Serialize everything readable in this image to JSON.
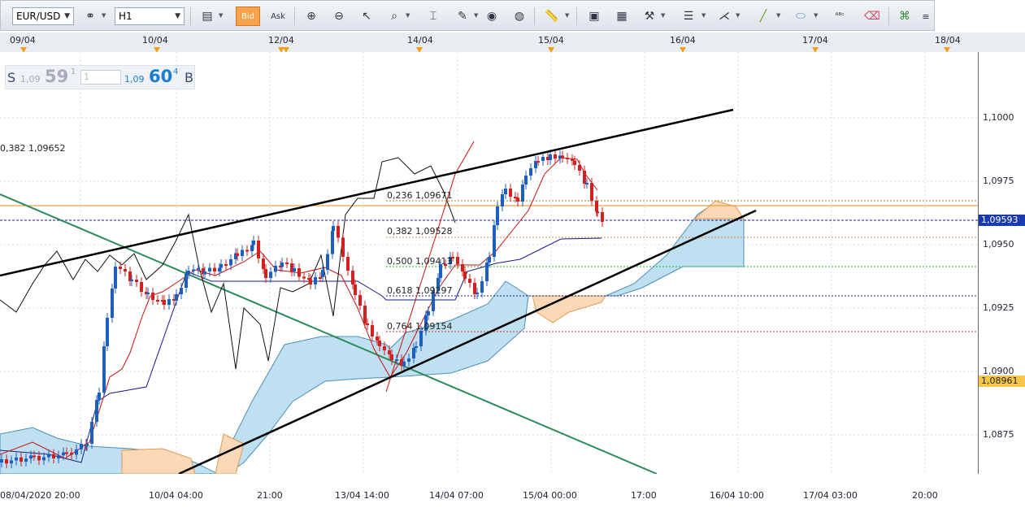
{
  "toolbar": {
    "symbol": "EUR/USD",
    "timeframe": "H1",
    "bid_label": "Bid",
    "ask_label": "Ask"
  },
  "top_dates": [
    "09/04",
    "10/04",
    "12/04",
    "14/04",
    "15/04",
    "16/04",
    "17/04",
    "18/04"
  ],
  "quote": {
    "sell_label": "S",
    "sell_prefix": "1,09",
    "sell_big": "59",
    "sell_sup": "1",
    "qty": "1",
    "buy_prefix": "1,09",
    "buy_big": "60",
    "buy_sup": "4",
    "buy_label": "B"
  },
  "price_axis": [
    "1,1000",
    "1,0975",
    "1,0950",
    "1,0925",
    "1,0900",
    "1,0875"
  ],
  "price_badges": {
    "current": "1,09593",
    "lower": "1,08961"
  },
  "time_axis": [
    "08/04/2020 20:00",
    "10/04 04:00",
    "21:00",
    "13/04 14:00",
    "14/04 07:00",
    "15/04 00:00",
    "17:00",
    "16/04 10:00",
    "17/04 03:00",
    "20:00"
  ],
  "fib_labels": [
    "0,382 1,09652",
    "0,236 1,09671",
    "0,382 1,09528",
    "0,500 1,09413",
    "0,618 1,09297",
    "0,764 1,09154"
  ],
  "colors": {
    "bull": "#1c5fbf",
    "bear": "#d02020",
    "cloud_bull": "#bfe0f0",
    "cloud_bear": "#fbd9b8",
    "accent": "#f6a24a"
  }
}
